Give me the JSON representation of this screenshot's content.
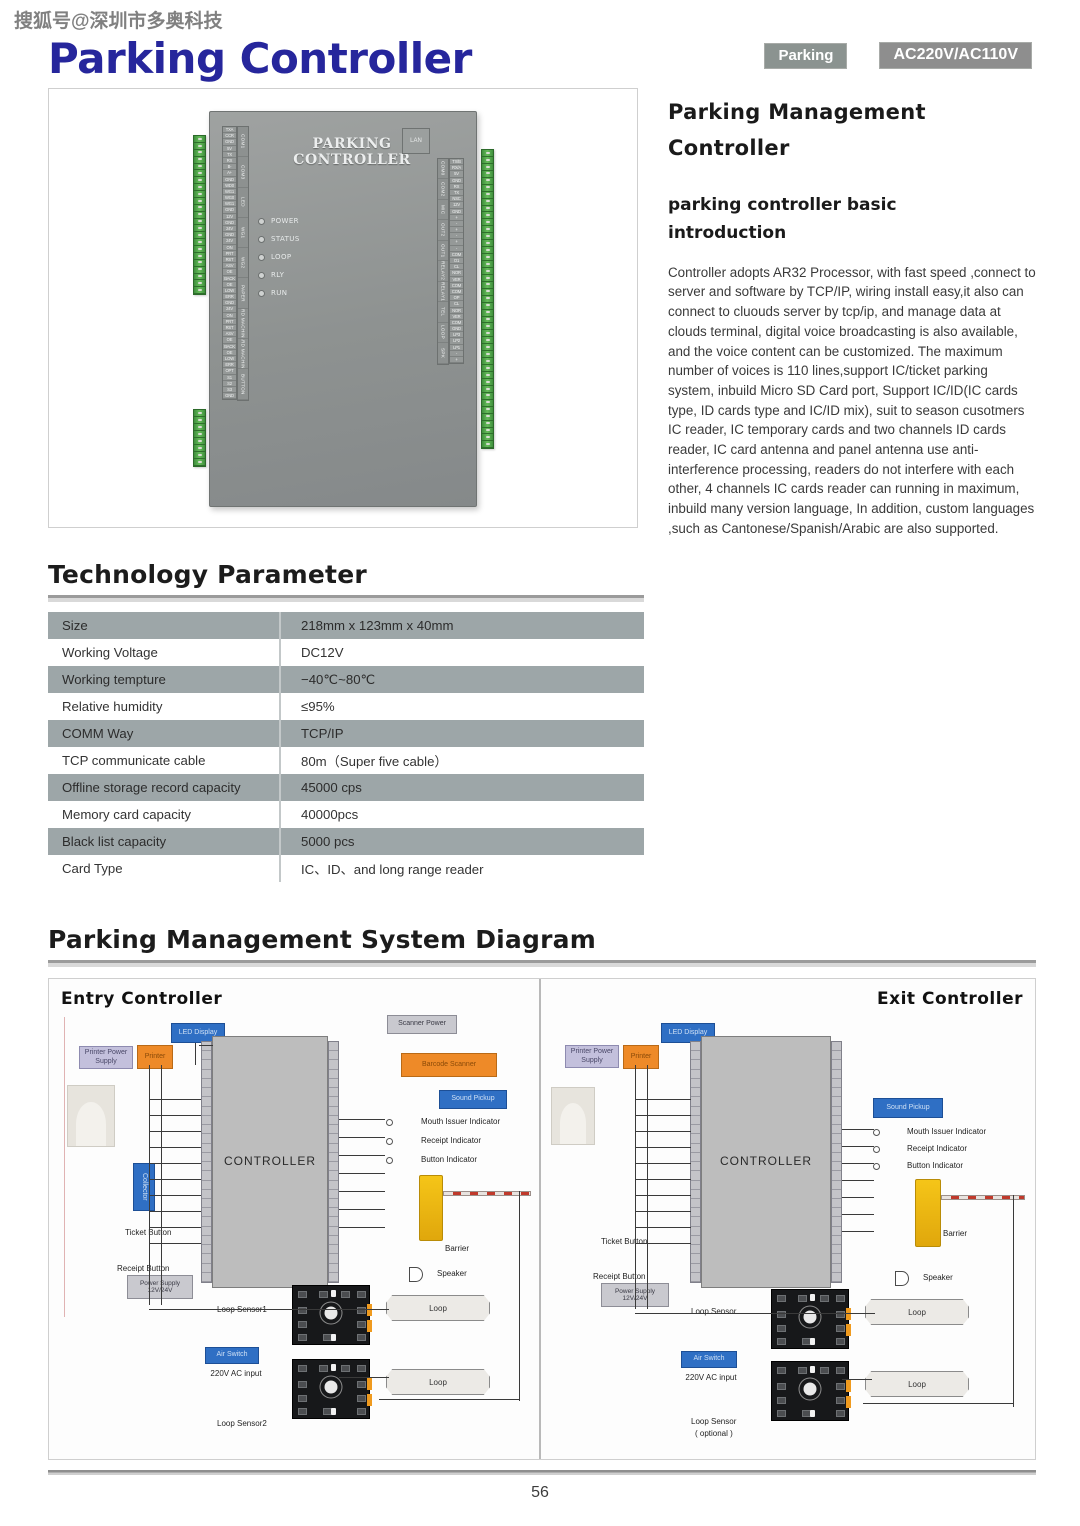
{
  "watermark": "搜狐号@深圳市多奥科技",
  "header": {
    "title": "Parking Controller",
    "badge_parking": "Parking",
    "badge_voltage": "AC220V/AC110V",
    "badge_parking_color": "#8b9390",
    "badge_voltage_color": "#8e8e8e",
    "title_color": "#26269c"
  },
  "product_photo": {
    "board_title": "PARKING CONTROLLER",
    "lan_port": "LAN",
    "leds": [
      "POWER",
      "STATUS",
      "LOOP",
      "RLY",
      "RUN"
    ],
    "left_terminals": [
      "TXA",
      "CCR",
      "GND",
      "5V",
      "TX",
      "RX",
      "B-",
      "A+",
      "GND",
      "WD0",
      "WG1",
      "WG0",
      "WG1",
      "GND",
      "12V",
      "GND",
      "24V",
      "GND",
      "24V",
      "ON",
      "PRT",
      "RST",
      "ASV",
      "OE",
      "BACK",
      "OE",
      "LOW",
      "ERR",
      "GND",
      "24V",
      "ON",
      "PRT",
      "RST",
      "ASV",
      "OE",
      "BACK",
      "OE",
      "LOW",
      "ERR",
      "OPT",
      "S1",
      "S2",
      "S3",
      "GND"
    ],
    "left_groups": [
      "COM1",
      "COM3",
      "LED",
      "WG1",
      "WG2",
      "PAPER",
      "CARD MACHINE1",
      "CARD MACHINE2",
      "BUTTON"
    ],
    "right_terminals": [
      "TX/B",
      "RX/A",
      "5V",
      "GND",
      "RX",
      "TX",
      "NSC",
      "12V",
      "GND",
      "+",
      "-",
      "+",
      "-",
      "+",
      "-",
      "COM",
      "O1",
      "CL",
      "NOR",
      "VER",
      "COM",
      "COM",
      "OP",
      "CL",
      "NOR",
      "VER",
      "COM",
      "GND",
      "LP3",
      "LP2",
      "LP1",
      "-",
      "+"
    ],
    "right_groups": [
      "COM0",
      "COM2",
      "MIC",
      "OUT2",
      "OUT1",
      "RELAY2",
      "RELAY1",
      "TEL",
      "LOOP",
      "SPK"
    ]
  },
  "intro": {
    "heading_line1": "Parking Management",
    "heading_line2": "Controller",
    "subheading_line1": "parking controller basic",
    "subheading_line2": "introduction",
    "body": "Controller adopts AR32 Processor, with fast speed ,connect to server and software by TCP/IP, wiring install easy,it also can connect to cluouds server by tcp/ip, and manage data at clouds terminal, digital voice broadcasting is also available, and the voice content can be customized. The maximum number of voices is 110 lines,support IC/ticket parking system, inbuild Micro SD Card port, Support IC/ID(IC cards type, ID cards type and IC/ID mix), suit to season cusotmers IC reader, IC temporary cards and two channels ID cards reader, IC card antenna and panel antenna use anti-interference processing, readers do not interfere with each other, 4 channels IC cards reader can running in maximum, inbuild many version language, In addition, custom languages ,such as Cantonese/Spanish/Arabic are also supported."
  },
  "tech_section": {
    "title": "Technology Parameter",
    "rows": [
      {
        "key": "Size",
        "value": "218mm x 123mm   x 40mm"
      },
      {
        "key": "Working Voltage",
        "value": "DC12V"
      },
      {
        "key": "Working tempture",
        "value": "−40℃~80℃"
      },
      {
        "key": "Relative humidity",
        "value": "≤95%"
      },
      {
        "key": "COMM Way",
        "value": "TCP/IP"
      },
      {
        "key": "TCP communicate cable",
        "value": "80m（Super five cable）"
      },
      {
        "key": "Offline storage record capacity",
        "value": "45000 cps"
      },
      {
        "key": "Memory card capacity",
        "value": "40000pcs"
      },
      {
        "key": "Black list capacity",
        "value": "5000 pcs"
      },
      {
        "key": "Card Type",
        "value": "IC、ID、and long range reader"
      }
    ]
  },
  "diagram_section": {
    "title": "Parking Management System Diagram",
    "entry": {
      "title": "Entry Controller",
      "led_display": "LED Display",
      "printer_power": "Printer Power Supply",
      "printer": "Printer",
      "controller": "CONTROLLER",
      "scanner_power": "Scanner Power",
      "barcode_scanner": "Barcode Scanner",
      "sound_pickup": "Sound Pickup",
      "collector": "Collector",
      "indicators": [
        "Mouth Issuer Indicator",
        "Receipt Indicator",
        "Button Indicator"
      ],
      "ticket_button": "Ticket Button",
      "receipt_button": "Receipt Button",
      "power_supply": "Power Supply 12V/24V",
      "air_switch": "Air Switch",
      "ac_input": "220V AC input",
      "loop_sensor1": "Loop Sensor1",
      "loop_sensor2": "Loop Sensor2",
      "loop1": "Loop",
      "loop2": "Loop",
      "barrier": "Barrier",
      "speaker": "Speaker"
    },
    "exit": {
      "title": "Exit Controller",
      "led_display": "LED Display",
      "printer_power": "Printer Power Supply",
      "printer": "Printer",
      "controller": "CONTROLLER",
      "sound_pickup": "Sound Pickup",
      "indicators": [
        "Mouth Issuer Indicator",
        "Receipt Indicator",
        "Button Indicator"
      ],
      "ticket_button": "Ticket Button",
      "receipt_button": "Receipt Button",
      "power_supply": "Power Supply 12V/24V",
      "air_switch": "Air Switch",
      "ac_input": "220V AC input",
      "loop_sensor1": "Loop Sensor",
      "loop_sensor2": "Loop Sensor",
      "loop_sensor2_note": "( optional )",
      "loop1": "Loop",
      "loop2": "Loop",
      "barrier": "Barrier",
      "speaker": "Speaker"
    }
  },
  "footer": {
    "page_number": "56"
  }
}
